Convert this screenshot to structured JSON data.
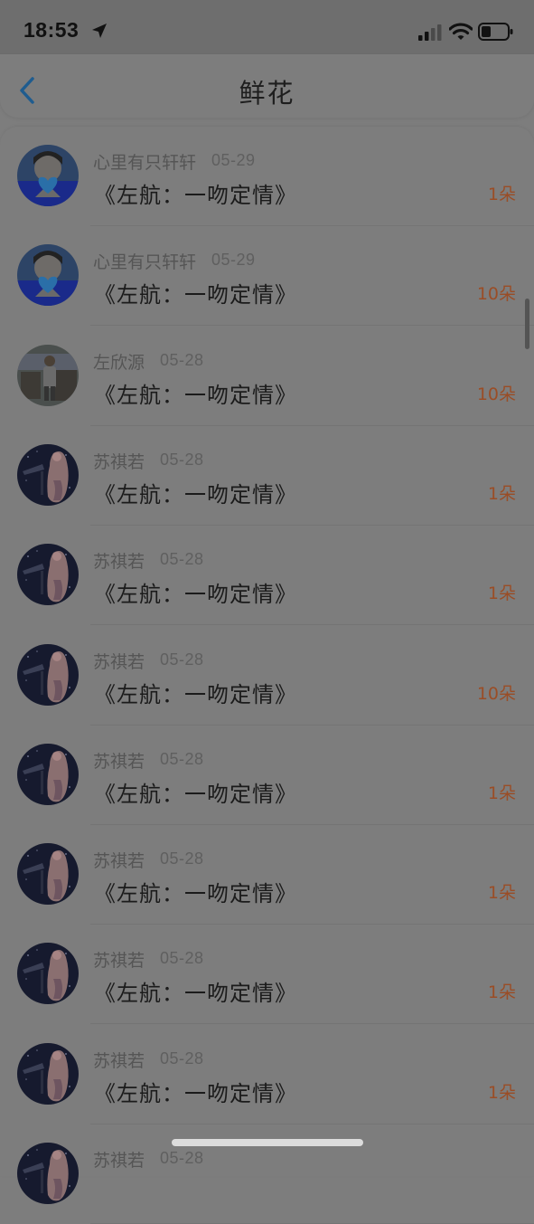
{
  "status": {
    "time": "18:53"
  },
  "nav": {
    "title": "鲜花"
  },
  "items": [
    {
      "user": "心里有只轩轩",
      "date": "05-29",
      "title": "《左航：一吻定情》",
      "count": "1朵",
      "avatar": "boy"
    },
    {
      "user": "心里有只轩轩",
      "date": "05-29",
      "title": "《左航：一吻定情》",
      "count": "10朵",
      "avatar": "boy"
    },
    {
      "user": "左欣源",
      "date": "05-28",
      "title": "《左航：一吻定情》",
      "count": "10朵",
      "avatar": "photo"
    },
    {
      "user": "苏祺若",
      "date": "05-28",
      "title": "《左航：一吻定情》",
      "count": "1朵",
      "avatar": "girl"
    },
    {
      "user": "苏祺若",
      "date": "05-28",
      "title": "《左航：一吻定情》",
      "count": "1朵",
      "avatar": "girl"
    },
    {
      "user": "苏祺若",
      "date": "05-28",
      "title": "《左航：一吻定情》",
      "count": "10朵",
      "avatar": "girl"
    },
    {
      "user": "苏祺若",
      "date": "05-28",
      "title": "《左航：一吻定情》",
      "count": "1朵",
      "avatar": "girl"
    },
    {
      "user": "苏祺若",
      "date": "05-28",
      "title": "《左航：一吻定情》",
      "count": "1朵",
      "avatar": "girl"
    },
    {
      "user": "苏祺若",
      "date": "05-28",
      "title": "《左航：一吻定情》",
      "count": "1朵",
      "avatar": "girl"
    },
    {
      "user": "苏祺若",
      "date": "05-28",
      "title": "《左航：一吻定情》",
      "count": "1朵",
      "avatar": "girl"
    },
    {
      "user": "苏祺若",
      "date": "05-28",
      "title": "",
      "count": "",
      "avatar": "girl"
    }
  ],
  "colors": {
    "overlay_bg": "#7d7d7d",
    "count_accent": "#9a4d26",
    "back_accent": "#1f5c8f"
  }
}
